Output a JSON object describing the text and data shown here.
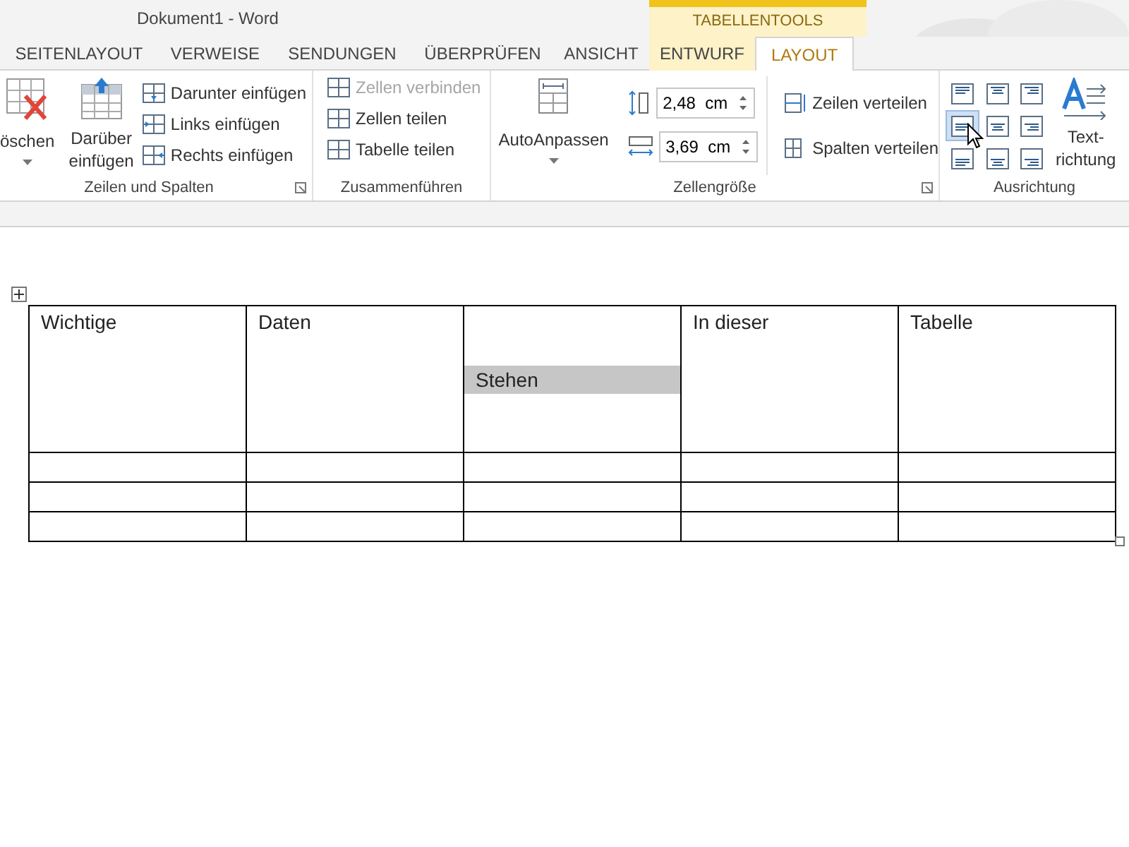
{
  "window": {
    "title": "Dokument1 - Word"
  },
  "context_tab_group": {
    "label": "TABELLENTOOLS"
  },
  "tabs": [
    {
      "label": "SEITENLAYOUT",
      "selected": false,
      "contextual": false
    },
    {
      "label": "VERWEISE",
      "selected": false,
      "contextual": false
    },
    {
      "label": "SENDUNGEN",
      "selected": false,
      "contextual": false
    },
    {
      "label": "ÜBERPRÜFEN",
      "selected": false,
      "contextual": false
    },
    {
      "label": "ANSICHT",
      "selected": false,
      "contextual": false
    },
    {
      "label": "ENTWURF",
      "selected": false,
      "contextual": true
    },
    {
      "label": "LAYOUT",
      "selected": true,
      "contextual": true
    }
  ],
  "ribbon": {
    "rows_columns": {
      "label": "Zeilen und Spalten",
      "delete_button": "öschen",
      "insert_above": [
        "Darüber",
        "einfügen"
      ],
      "commands": [
        {
          "label": "Darunter einfügen",
          "disabled": false
        },
        {
          "label": "Links einfügen",
          "disabled": false
        },
        {
          "label": "Rechts einfügen",
          "disabled": false
        }
      ]
    },
    "merge": {
      "label": "Zusammenführen",
      "commands": [
        {
          "label": "Zellen verbinden",
          "disabled": true
        },
        {
          "label": "Zellen teilen",
          "disabled": false
        },
        {
          "label": "Tabelle teilen",
          "disabled": false
        }
      ]
    },
    "autofit": {
      "label": "AutoAnpassen"
    },
    "cell_size": {
      "label": "Zellengröße",
      "height": "2,48  cm",
      "width": "3,69  cm",
      "distribute": [
        "Zeilen verteilen",
        "Spalten verteilen"
      ]
    },
    "alignment": {
      "label": "Ausrichtung",
      "buttons": [
        {
          "selected": false
        },
        {
          "selected": false
        },
        {
          "selected": false
        },
        {
          "selected": true
        },
        {
          "selected": false
        },
        {
          "selected": false
        },
        {
          "selected": false
        },
        {
          "selected": false
        },
        {
          "selected": false
        }
      ],
      "text_direction": [
        "Text-",
        "richtung"
      ]
    }
  },
  "table": {
    "rows": [
      [
        {
          "text": "Wichtige",
          "selected": false
        },
        {
          "text": "Daten",
          "selected": false
        },
        {
          "text": "Stehen",
          "selected": true
        },
        {
          "text": "In dieser",
          "selected": false
        },
        {
          "text": "Tabelle",
          "selected": false
        }
      ],
      [
        {},
        {},
        {},
        {},
        {}
      ],
      [
        {},
        {},
        {},
        {},
        {}
      ],
      [
        {},
        {},
        {},
        {},
        {}
      ]
    ]
  }
}
